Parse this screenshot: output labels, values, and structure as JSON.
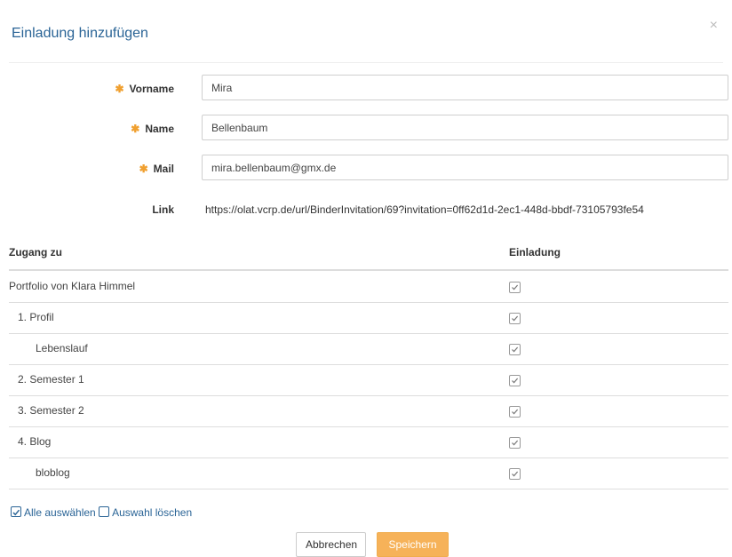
{
  "dialog": {
    "title": "Einladung hinzufügen",
    "close_icon": "×"
  },
  "form": {
    "firstname": {
      "label": "Vorname",
      "required": true,
      "value": "Mira"
    },
    "lastname": {
      "label": "Name",
      "required": true,
      "value": "Bellenbaum"
    },
    "mail": {
      "label": "Mail",
      "required": true,
      "value": "mira.bellenbaum@gmx.de"
    },
    "link": {
      "label": "Link",
      "value": "https://olat.vcrp.de/url/BinderInvitation/69?invitation=0ff62d1d-2ec1-448d-bbdf-73105793fe54"
    },
    "required_marker": "✱"
  },
  "table": {
    "headers": {
      "access": "Zugang zu",
      "invitation": "Einladung"
    },
    "rows": [
      {
        "label": "Portfolio von Klara Himmel",
        "checked": true
      },
      {
        "label": "1. Profil",
        "checked": true
      },
      {
        "label": "Lebenslauf",
        "checked": true
      },
      {
        "label": "2. Semester 1",
        "checked": true
      },
      {
        "label": "3. Semester 2",
        "checked": true
      },
      {
        "label": "4. Blog",
        "checked": true
      },
      {
        "label": "bloblog",
        "checked": true
      }
    ]
  },
  "selection": {
    "select_all": "Alle auswählen",
    "clear": "Auswahl löschen"
  },
  "buttons": {
    "cancel": "Abbrechen",
    "save": "Speichern"
  },
  "colors": {
    "accent": "#2a6496",
    "required": "#f0a030",
    "primary_button": "#f6b259"
  }
}
